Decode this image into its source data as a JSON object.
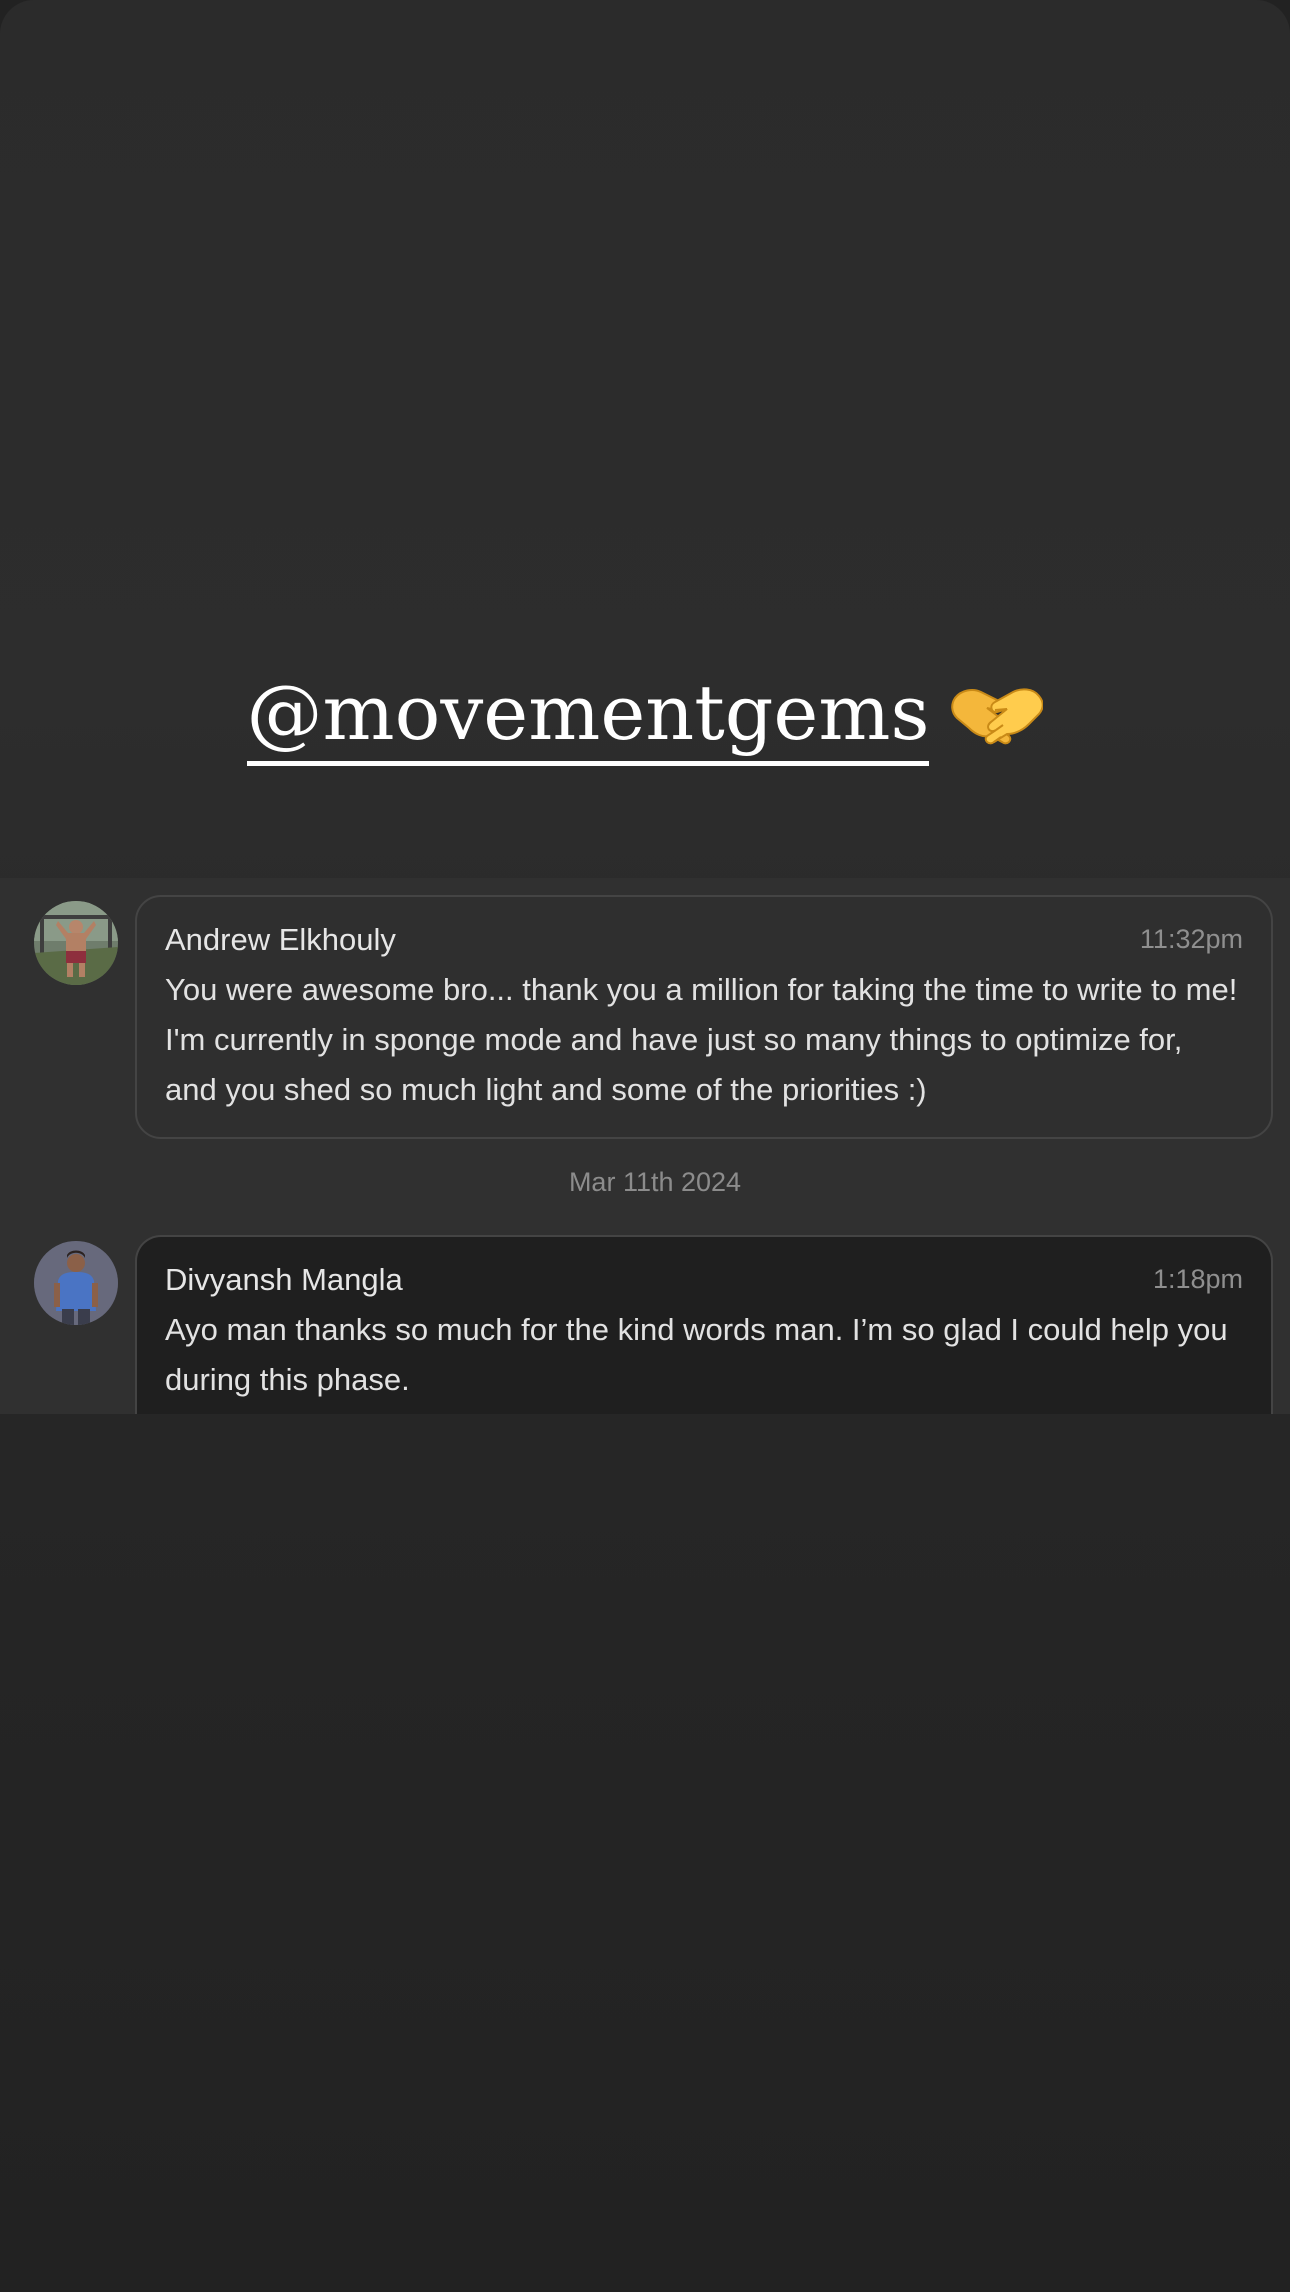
{
  "story": {
    "mention": "@movementgems",
    "mention_icon": "handshake-emoji"
  },
  "chat": {
    "messages": [
      {
        "sender": "Andrew Elkhouly",
        "time": "11:32pm",
        "text": "You were awesome bro... thank you a million for taking the time to write to me! I'm currently in sponge mode and have just so many things to optimize for, and you shed so much light and some of the priorities :)"
      },
      {
        "sender": "Divyansh Mangla",
        "time": "1:18pm",
        "text": "Ayo man thanks so much for the kind words man. I’m so glad I could help you during this phase."
      }
    ],
    "date_separator": "Mar 11th 2024"
  },
  "colors": {
    "background": "#2b2b2b",
    "chat_panel": "#303030",
    "bubble_border": "#444444",
    "text": "#e2e2e2",
    "muted": "#8c8c8c"
  }
}
